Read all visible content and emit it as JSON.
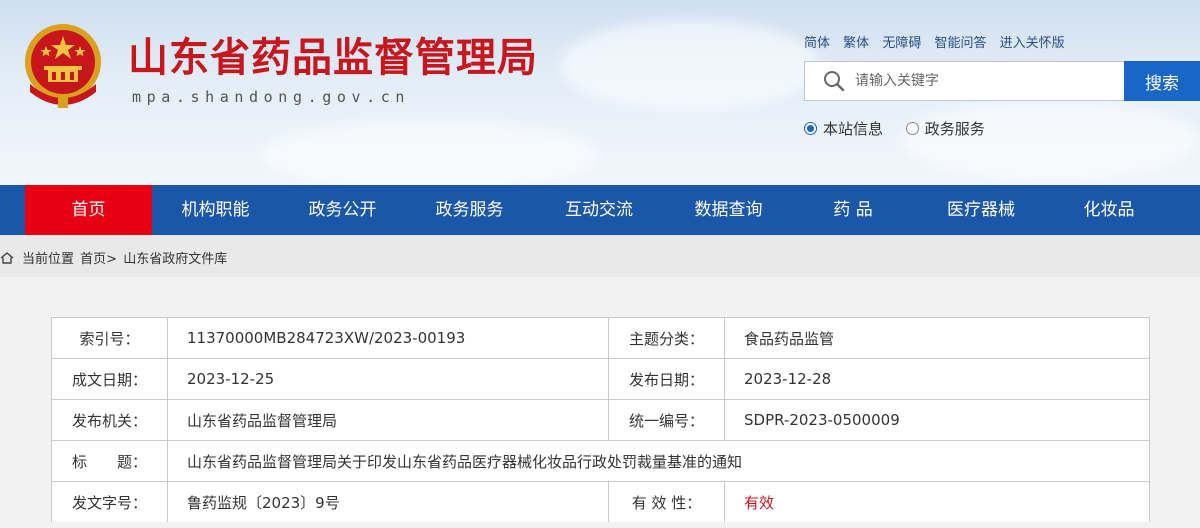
{
  "header": {
    "site_title": "山东省药品监督管理局",
    "site_domain": "mpa.shandong.gov.cn",
    "emblem_icon": "national-emblem-icon",
    "top_links": [
      "简体",
      "繁体",
      "无障碍",
      "智能问答",
      "进入关怀版"
    ],
    "search": {
      "placeholder": "请输入关键字",
      "button_label": "搜索",
      "icon": "search-icon"
    },
    "scope_options": [
      {
        "label": "本站信息",
        "selected": true
      },
      {
        "label": "政务服务",
        "selected": false
      }
    ]
  },
  "nav": {
    "items": [
      "首页",
      "机构职能",
      "政务公开",
      "政务服务",
      "互动交流",
      "数据查询",
      "药 品",
      "医疗器械",
      "化妆品"
    ],
    "active_index": 0,
    "bg_color": "#1b57a8",
    "active_color": "#e60012"
  },
  "breadcrumb": {
    "icon": "home-icon",
    "prefix": "当前位置",
    "items": [
      "首页>",
      "山东省政府文件库"
    ]
  },
  "info": {
    "index_label": "索引号：",
    "index_value": "11370000MB284723XW/2023-00193",
    "topic_label": "主题分类：",
    "topic_value": "食品药品监管",
    "written_date_label": "成文日期：",
    "written_date_value": "2023-12-25",
    "publish_date_label": "发布日期：",
    "publish_date_value": "2023-12-28",
    "issuer_label": "发布机关：",
    "issuer_value": "山东省药品监督管理局",
    "unified_no_label": "统一编号：",
    "unified_no_value": "SDPR-2023-0500009",
    "title_label": "标　　题：",
    "title_value": "山东省药品监督管理局关于印发山东省药品医疗器械化妆品行政处罚裁量基准的通知",
    "doc_no_label": "发文字号：",
    "doc_no_value": "鲁药监规〔2023〕9号",
    "validity_label": "有 效 性：",
    "validity_value": "有效",
    "validity_color": "#c8161d"
  }
}
